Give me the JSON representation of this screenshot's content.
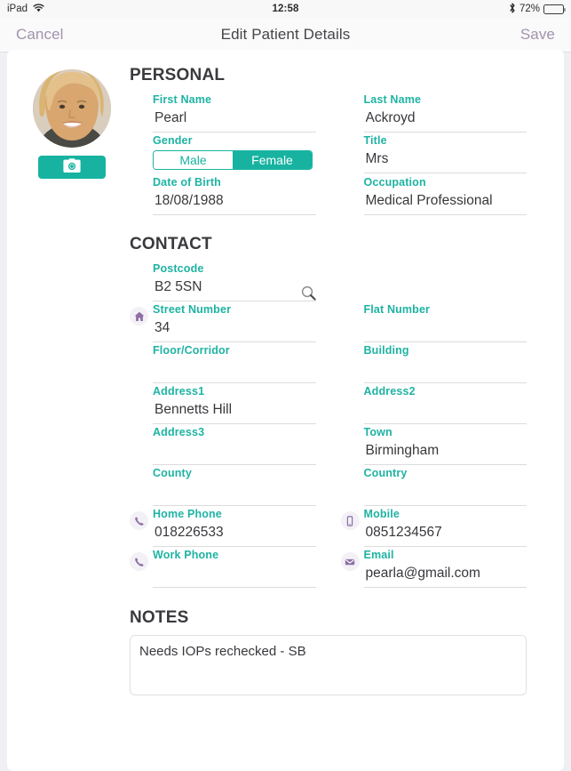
{
  "status_bar": {
    "device": "iPad",
    "wifi_icon": "wifi-icon",
    "time": "12:58",
    "bluetooth_icon": "bluetooth-icon",
    "battery_percent": "72%",
    "battery_level": 72
  },
  "nav": {
    "cancel_label": "Cancel",
    "title": "Edit Patient Details",
    "save_label": "Save",
    "accent_color": "#a193ad"
  },
  "theme": {
    "teal": "#17b3a0",
    "label_teal": "#1eb3a3",
    "icon_purple": "#8e6fa8",
    "icon_bg": "#f3f1f6"
  },
  "avatar": {
    "camera_icon": "camera-icon"
  },
  "sections": {
    "personal": "PERSONAL",
    "contact": "CONTACT",
    "notes": "NOTES"
  },
  "personal": {
    "first_name": {
      "label": "First Name",
      "value": "Pearl",
      "placeholder": ""
    },
    "last_name": {
      "label": "Last Name",
      "value": "Ackroyd",
      "placeholder": ""
    },
    "gender": {
      "label": "Gender",
      "options": [
        "Male",
        "Female"
      ],
      "selected": "Female"
    },
    "title": {
      "label": "Title",
      "value": "Mrs",
      "placeholder": ""
    },
    "date_of_birth": {
      "label": "Date of Birth",
      "value": "18/08/1988",
      "placeholder": ""
    },
    "occupation": {
      "label": "Occupation",
      "value": "Medical Professional",
      "placeholder": ""
    }
  },
  "contact": {
    "postcode": {
      "label": "Postcode",
      "value": "B2 5SN",
      "placeholder": "",
      "search_icon": "search-icon"
    },
    "street_number": {
      "label": "Street Number",
      "value": "34",
      "placeholder": "",
      "icon": "home-icon"
    },
    "flat_number": {
      "label": "Flat Number",
      "value": "",
      "placeholder": ""
    },
    "floor_corridor": {
      "label": "Floor/Corridor",
      "value": "",
      "placeholder": ""
    },
    "building": {
      "label": "Building",
      "value": "",
      "placeholder": ""
    },
    "address1": {
      "label": "Address1",
      "value": "Bennetts Hill",
      "placeholder": ""
    },
    "address2": {
      "label": "Address2",
      "value": "",
      "placeholder": ""
    },
    "address3": {
      "label": "Address3",
      "value": "",
      "placeholder": ""
    },
    "town": {
      "label": "Town",
      "value": "Birmingham",
      "placeholder": ""
    },
    "county": {
      "label": "County",
      "value": "",
      "placeholder": ""
    },
    "country": {
      "label": "Country",
      "value": "",
      "placeholder": ""
    },
    "home_phone": {
      "label": "Home Phone",
      "value": "018226533",
      "placeholder": "",
      "icon": "phone-icon"
    },
    "mobile": {
      "label": "Mobile",
      "value": "0851234567",
      "placeholder": "",
      "icon": "mobile-icon"
    },
    "work_phone": {
      "label": "Work Phone",
      "value": "",
      "placeholder": "",
      "icon": "phone-icon"
    },
    "email": {
      "label": "Email",
      "value": "pearla@gmail.com",
      "placeholder": "",
      "icon": "envelope-icon"
    }
  },
  "notes": {
    "value": "Needs IOPs rechecked - SB",
    "placeholder": ""
  }
}
